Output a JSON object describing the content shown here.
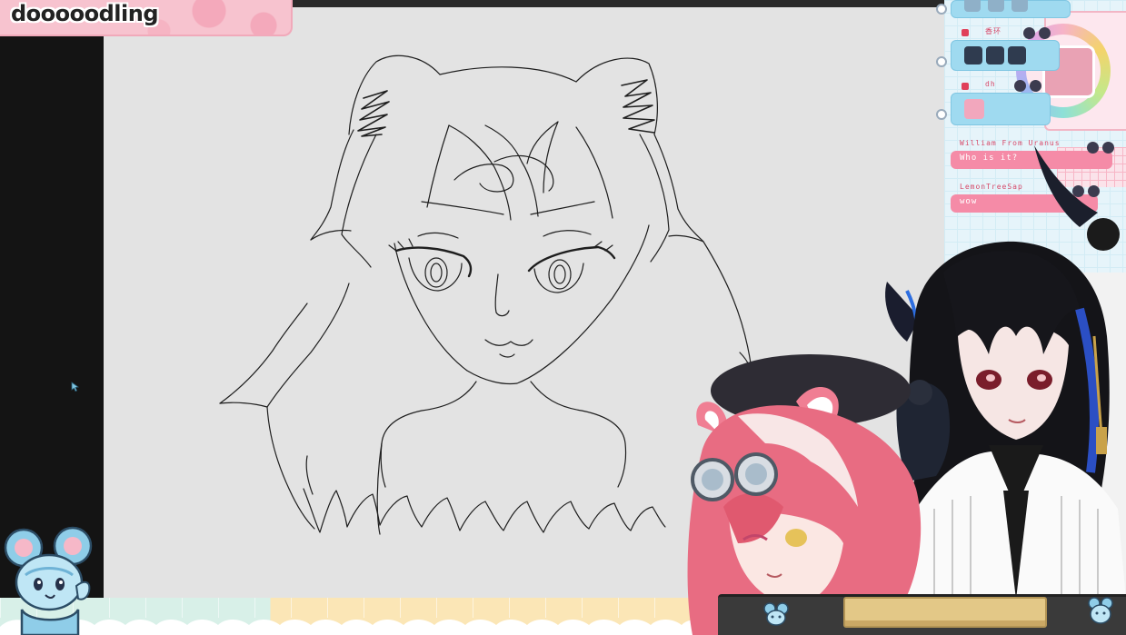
{
  "overlay": {
    "title": "dooooodling"
  },
  "chat": {
    "messages": [
      {
        "type": "emote",
        "username": ""
      },
      {
        "type": "emote",
        "username": "香环"
      },
      {
        "type": "emote",
        "username": "dh"
      },
      {
        "type": "text",
        "username": "William From Uranus",
        "text": "Who is it?"
      },
      {
        "type": "text",
        "username": "LemonTreeSap",
        "text": "wow"
      }
    ]
  },
  "colors": {
    "canvas": "#e3e3e3",
    "accent_pink": "#f58ba7",
    "chat_blue": "#9fdaf0",
    "frame_dark": "#141414"
  },
  "icons": {
    "cursor": "pen-cursor-icon",
    "mascot": "blue-mouse-mascot-icon"
  }
}
